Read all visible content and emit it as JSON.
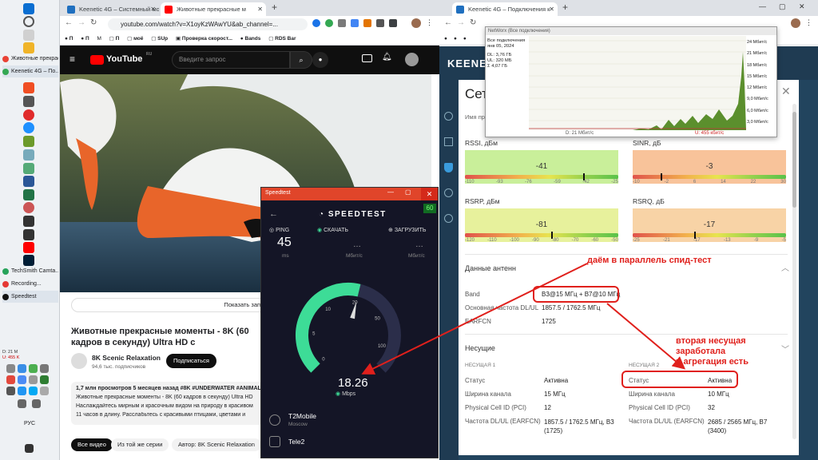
{
  "taskbar": {
    "apps": [
      "Животные прекрас...",
      "Keenetic 4G – По...",
      "TechSmith Camta...",
      "Recording...",
      "Speedtest"
    ],
    "tray_speed_down": "D: 21 M",
    "tray_speed_up": "U: 455 K",
    "language": "РУС"
  },
  "youtube_window": {
    "tabs": [
      "Keenetic 4G – Системный мо",
      "Животные прекрасные м"
    ],
    "url": "youtube.com/watch?v=X1oyKzWAwYU&ab_channel=...",
    "bookmarks": [
      "П",
      "П",
      "M",
      "П",
      "моё",
      "SUp",
      "Проверка скорост...",
      "Bands",
      "RDS Bar"
    ],
    "search_placeholder": "Введите запрос",
    "logo": "YouTube",
    "logo_region": "RU",
    "show_chat": "Показать запис",
    "video_title": "Животные прекрасные моменты - 8K (60 кадров в секунду) Ultra HD с расслабляющей музыкой",
    "channel_name": "8K Scenic Relaxation",
    "subscribers": "94,6 тыс. подписчиков",
    "subscribe": "Подписаться",
    "views": "1,7 млн просмотров  5 месяцев назад  #8K #UNDERWATER #ANIMALS",
    "desc_line1": "Животные прекрасные моменты - 8K (60 кадров в секунду) Ultra HD",
    "desc_line2": "Наслаждайтесь мирным и красочным видом на природу в красивом",
    "desc_line3": "11 часов в длину. Расслабьтесь с красивыми птицами, цветами и",
    "chips": [
      "Все видео",
      "Из той же серии",
      "Автор: 8K Scenic Relaxation"
    ]
  },
  "keenetic_window": {
    "tab": "Keenetic 4G – Подключения к",
    "logo": "KEENETIC",
    "title": "Сет",
    "subtitle": "Имя пр",
    "rssi": {
      "label": "RSSI, дБм",
      "value": "-41",
      "ticks": [
        "-110",
        "-93",
        "-76",
        "-59",
        "-42",
        "-25"
      ],
      "marker": 0.77
    },
    "sinr": {
      "label": "SINR, дБ",
      "value": "-3",
      "ticks": [
        "-10",
        "-2",
        "6",
        "14",
        "22",
        "30"
      ],
      "marker": 0.18
    },
    "rsrp": {
      "label": "RSRP, дБм",
      "value": "-81",
      "ticks": [
        "-120",
        "-110",
        "-100",
        "-90",
        "-80",
        "-70",
        "-60",
        "-50"
      ],
      "marker": 0.56
    },
    "rsrq": {
      "label": "RSRQ, дБ",
      "value": "-17",
      "ticks": [
        "-25",
        "-21",
        "-17",
        "-13",
        "-9",
        "-5"
      ],
      "marker": 0.4
    },
    "antenna_section": "Данные антенн",
    "band_label": "Band",
    "band_value": "B3@15 МГц + B7@10 МГц",
    "freq_label": "Основная частота DL/UL",
    "freq_value": "1857.5 / 1762.5 МГц",
    "earfcn_label": "EARFCN",
    "earfcn_value": "1725",
    "carriers_section": "Несущие",
    "carrier1": {
      "title": "НЕСУЩАЯ 1",
      "status_label": "Статус",
      "status": "Активна",
      "width_label": "Ширина канала",
      "width": "15 МГц",
      "pci_label": "Physical Cell ID (PCI)",
      "pci": "12",
      "freq_label": "Частота DL/UL (EARFCN)",
      "freq": "1857.5 / 1762.5 МГц, B3 (1725)"
    },
    "carrier2": {
      "title": "НЕСУЩАЯ 2",
      "status_label": "Статус",
      "status": "Активна",
      "width_label": "Ширина канала",
      "width": "10 МГц",
      "pci_label": "Physical Cell ID (PCI)",
      "pci": "32",
      "freq_label": "Частота DL/UL (EARFCN)",
      "freq": "2685 / 2565 МГц, B7 (3400)"
    }
  },
  "networx": {
    "title": "NetWorx (Все подключения)",
    "info": [
      "Все подключения",
      "янв 05, 2024",
      "DL: 3,76 ГБ",
      "UL: 320 МБ",
      "Σ 4,07 ГБ"
    ],
    "y_ticks": [
      "24 Мбит/с",
      "21 Мбит/с",
      "18 Мбит/с",
      "15 Мбит/с",
      "12 Мбит/с",
      "9,0 Мбит/с",
      "6,0 Мбит/с",
      "3,0 Мбит/с"
    ],
    "footer_d": "D: 21 Мбит/с",
    "footer_u": "U: 455 кбит/с"
  },
  "speedtest": {
    "window_title": "Speedtest",
    "header": "SPEEDTEST",
    "ping_label": "PING",
    "ping_value": "45",
    "ping_unit": "ms",
    "download_label": "СКАЧАТЬ",
    "download_unit": "Мбит/с",
    "upload_label": "ЗАГРУЗИТЬ",
    "upload_unit": "Мбит/с",
    "speed": "18.26",
    "speed_unit": "Mbps",
    "gauge_labels": [
      "0",
      "5",
      "10",
      "20",
      "50",
      "100"
    ],
    "server": "T2Mobile",
    "server_city": "Moscow",
    "provider": "Tele2",
    "side_badge": "60",
    "progress": 0.55
  },
  "annotations": {
    "parallel": "даём в параллель спид-тест",
    "second_carrier": "вторая несущая\nзаработала\n= агрегация есть"
  },
  "colors": {
    "annotation": "#e0201c",
    "speed_arc": "#3ddc97",
    "speedtest_bg": "#141526",
    "keenetic_dark": "#1f3b52",
    "youtube_bg": "#0f0f0f"
  }
}
